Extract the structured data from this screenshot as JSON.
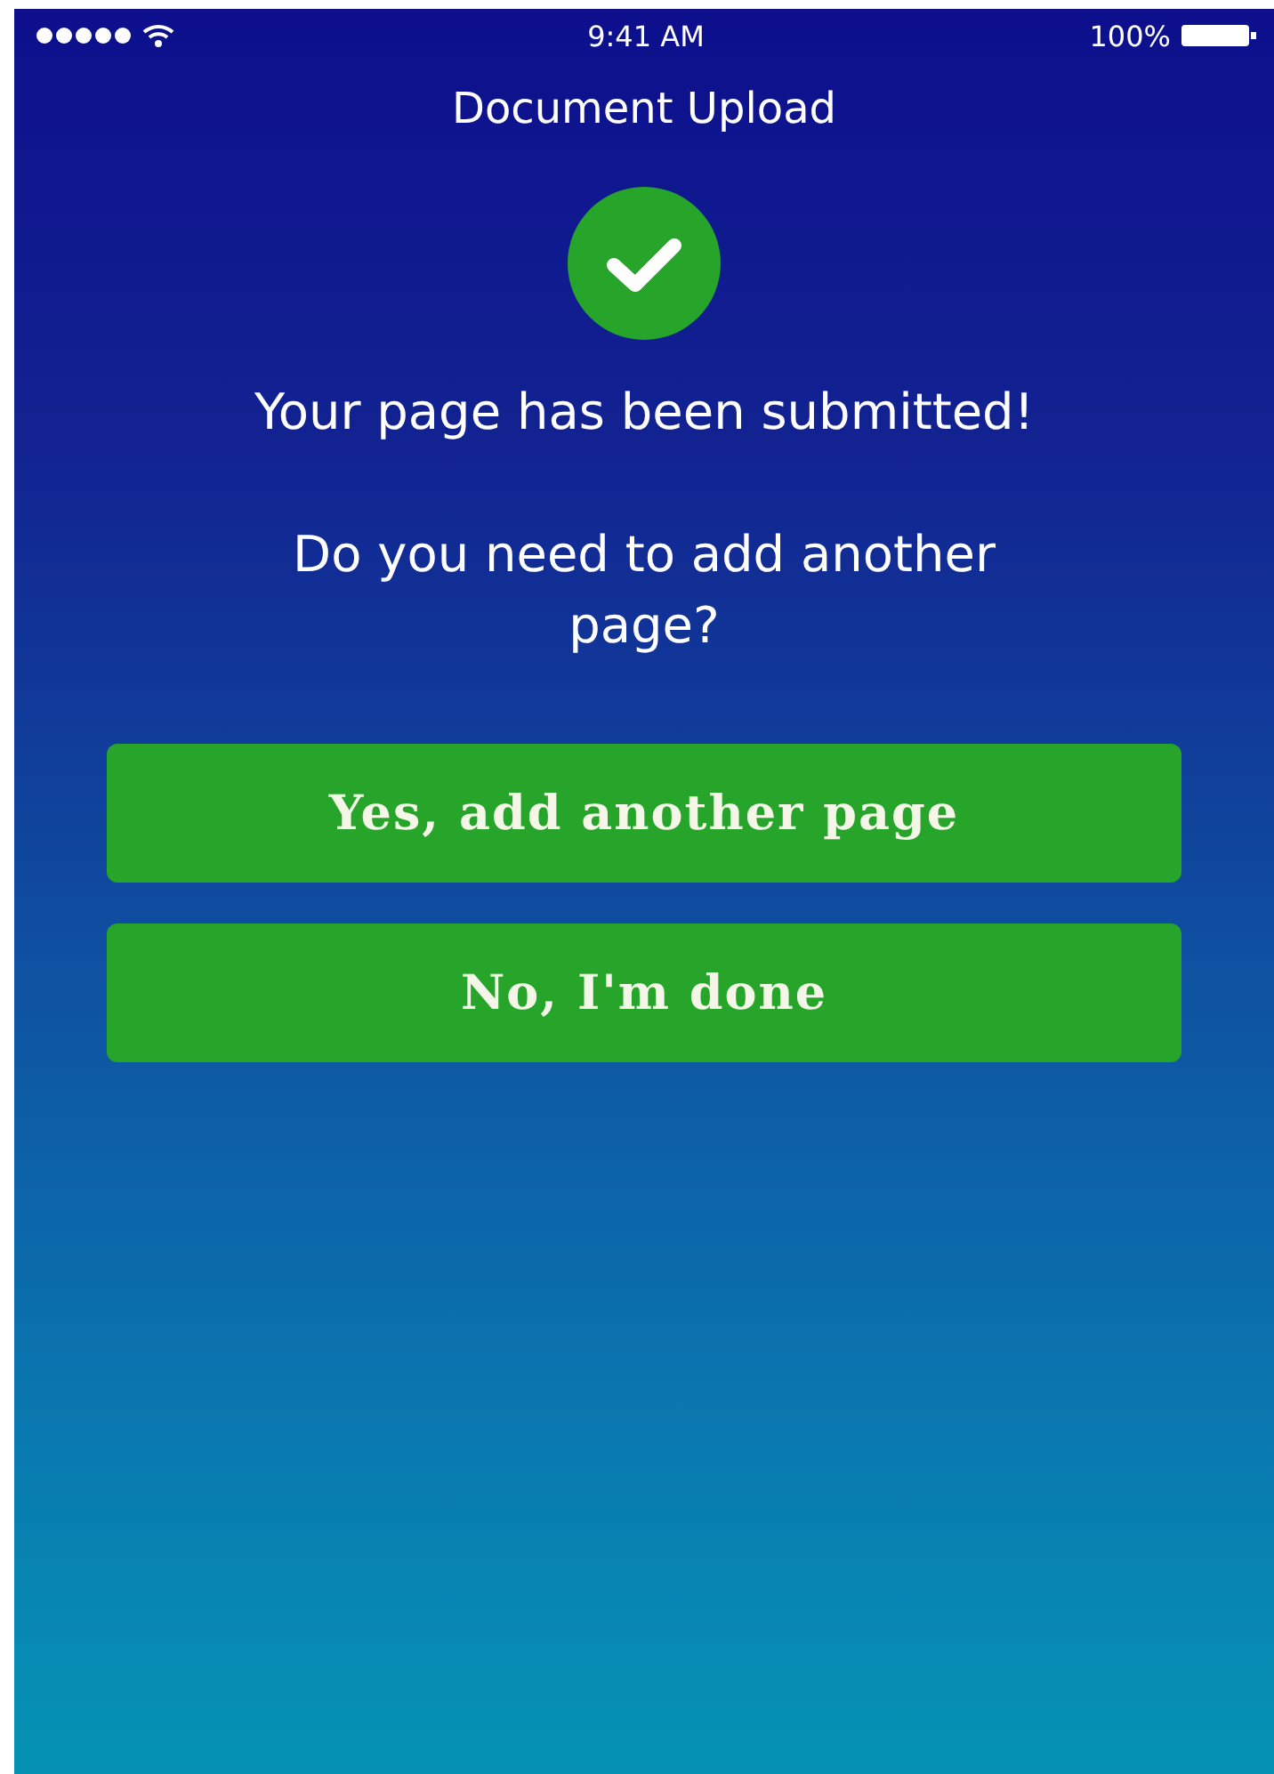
{
  "status_bar": {
    "time": "9:41 AM",
    "battery": "100%"
  },
  "title": "Document Upload",
  "message": "Your page has been submitted!",
  "question": "Do you need to add another page?",
  "buttons": [
    {
      "label": "Yes, add another page"
    },
    {
      "label": "No, I'm done"
    }
  ]
}
